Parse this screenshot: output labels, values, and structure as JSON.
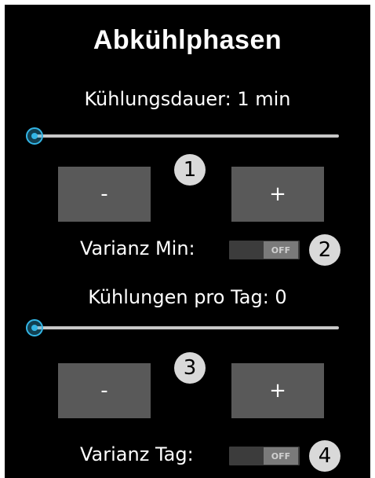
{
  "title": "Abkühlphasen",
  "section1": {
    "label": "Kühlungsdauer: 1 min",
    "slider_value_fraction": 0.0,
    "minus_label": "-",
    "plus_label": "+",
    "badge": "1",
    "toggle_label": "Varianz Min:",
    "toggle_state": "OFF",
    "toggle_badge": "2"
  },
  "section2": {
    "label": "Kühlungen pro Tag: 0",
    "slider_value_fraction": 0.0,
    "minus_label": "-",
    "plus_label": "+",
    "badge": "3",
    "toggle_label": "Varianz Tag:",
    "toggle_state": "OFF",
    "toggle_badge": "4"
  },
  "colors": {
    "background": "#000000",
    "accent": "#33b5e5",
    "button": "#595959",
    "badge": "#d9d9d9"
  }
}
